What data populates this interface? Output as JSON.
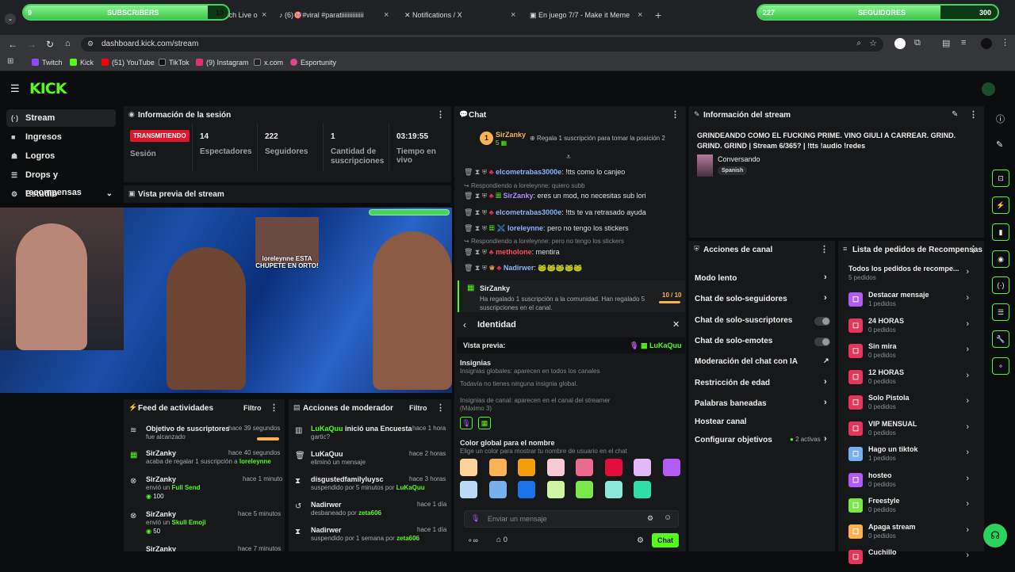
{
  "overlays": {
    "subs": {
      "current": "9",
      "label": "SUBSCRIBERS",
      "goal": "10",
      "progress": 0.9
    },
    "followers": {
      "current": "227",
      "label": "SEGUIDORES",
      "goal": "300",
      "progress": 0.76
    }
  },
  "browser": {
    "tabs": [
      {
        "label": "Watch Live o"
      },
      {
        "label": "(6)🎯#viral #paratiiiiiiiiiiiiii"
      },
      {
        "label": "Notifications / X"
      },
      {
        "label": "En juego 7/7 - Make it Meme"
      }
    ],
    "url": "dashboard.kick.com/stream",
    "bookmarks": [
      "Twitch",
      "Kick",
      "(51) YouTube",
      "TikTok",
      "(9) Instagram",
      "x.com",
      "Esportunity"
    ]
  },
  "nav": {
    "items": [
      {
        "label": "Stream"
      },
      {
        "label": "Ingresos"
      },
      {
        "label": "Logros"
      },
      {
        "label": "Drops y recompensas"
      },
      {
        "label": "Estudio"
      }
    ]
  },
  "session": {
    "title": "Información de la sesión",
    "status": "TRANSMITIENDO",
    "session_label": "Sesión",
    "stats": [
      {
        "value": "14",
        "label": "Espectadores"
      },
      {
        "value": "222",
        "label": "Seguidores"
      },
      {
        "value": "1",
        "label": "Cantidad de suscripciones"
      },
      {
        "value": "03:19:55",
        "label": "Tiempo en vivo"
      }
    ]
  },
  "preview": {
    "title": "Vista previa del stream",
    "overlay_text": "loreleynne ESTA CHUPETE EN ORTO!"
  },
  "chat": {
    "title": "Chat",
    "pinned_user": "SirZanky",
    "pinned_count": "5",
    "pinned_rank": "1",
    "gift_hint": "Regala 1 suscripción para tomar la posición 2",
    "messages": [
      {
        "user": "elcometrabas3000e",
        "text": "!tts como lo canjeo",
        "reply": ""
      },
      {
        "user": "SirZanky",
        "text": "eres un mod, no necesitas sub lori",
        "reply": "Respondiendo a loreleynne: quiero subb"
      },
      {
        "user": "elcometrabas3000e",
        "text": "!tts te va retrasado ayuda",
        "reply": ""
      },
      {
        "user": "loreleynne",
        "text": "pero no tengo los stickers",
        "reply": ""
      },
      {
        "user": "metholone",
        "text": "mentira",
        "reply": "Respondiendo a loreleynne: pero no tengo los stickers"
      },
      {
        "user": "Nadirwer",
        "text": "",
        "reply": ""
      }
    ],
    "gift_event": {
      "user": "SirZanky",
      "text": "Ha regalado 1 suscripción a la comunidad. Han regalado 5 suscripciones en el canal.",
      "progress": "10 / 10"
    },
    "identity": {
      "title": "Identidad",
      "preview_label": "Vista previa:",
      "preview_name": "LuKaQuu",
      "badges_title": "Insignias",
      "badges_global": "Insignias globales: aparecen en todos los canales",
      "badges_none": "Todavía no tienes ninguna insignia global.",
      "badges_channel": "Insignias de canal: aparecen en el canal del streamer",
      "badges_max": "(Máximo 3)",
      "color_title": "Color global para el nombre",
      "color_hint": "Elige un color para mostrar tu nombre de usuario en el chat",
      "colors": [
        "#fcd49b",
        "#fbb253",
        "#f59e0b",
        "#f9c8d4",
        "#ea6b8f",
        "#e20f3d",
        "#e2b8f7",
        "#b35cf5",
        "#b9d9f7",
        "#76b0ef",
        "#1c72e8",
        "#cdf5a4",
        "#7ae84a",
        "#8ae8d9",
        "#2ee0a8"
      ]
    },
    "input_placeholder": "Enviar un mensaje",
    "count": "0",
    "send_label": "Chat"
  },
  "stream_info": {
    "title": "Información del stream",
    "stream_title": "GRINDEANDO COMO EL FUCKING PRIME. VINO GIULI A CARREAR. GRIND. GRIND. GRIND | Stream 6/365? | !tts !audio !redes",
    "category": "Conversando",
    "tag": "Spanish"
  },
  "channel_actions": {
    "title": "Acciones de canal",
    "items": [
      {
        "label": "Modo lento"
      },
      {
        "label": "Chat de solo-seguidores"
      },
      {
        "label": "Chat de solo-suscriptores"
      },
      {
        "label": "Chat de solo-emotes"
      },
      {
        "label": "Moderación del chat con IA"
      },
      {
        "label": "Restricción de edad"
      },
      {
        "label": "Palabras baneadas"
      },
      {
        "label": "Hostear canal"
      },
      {
        "label": "Configurar objetivos"
      }
    ],
    "goals_active": "2 activas"
  },
  "rewards": {
    "title": "Lista de pedidos de Recompensas",
    "all": {
      "label": "Todos los pedidos de recompe...",
      "count": "5 pedidos"
    },
    "items": [
      {
        "label": "Destacar mensaje",
        "count": "1 pedidos",
        "color": "#b35cf5"
      },
      {
        "label": "24 HORAS",
        "count": "0 pedidos",
        "color": "#e2365a"
      },
      {
        "label": "Sin mira",
        "count": "0 pedidos",
        "color": "#e2365a"
      },
      {
        "label": "12 HORAS",
        "count": "0 pedidos",
        "color": "#e2365a"
      },
      {
        "label": "Solo Pistola",
        "count": "0 pedidos",
        "color": "#e2365a"
      },
      {
        "label": "VIP MENSUAL",
        "count": "0 pedidos",
        "color": "#e2365a"
      },
      {
        "label": "Hago un tiktok",
        "count": "1 pedidos",
        "color": "#76b0ef"
      },
      {
        "label": "hosteo",
        "count": "0 pedidos",
        "color": "#b35cf5"
      },
      {
        "label": "Freestyle",
        "count": "0 pedidos",
        "color": "#7ae84a"
      },
      {
        "label": "Apaga stream",
        "count": "0 pedidos",
        "color": "#fbb253"
      },
      {
        "label": "Cuchillo",
        "count": "",
        "color": "#e2365a"
      }
    ]
  },
  "activity": {
    "title": "Feed de actividades",
    "filter": "Filtro",
    "items": [
      {
        "name": "Objetivo de suscriptores",
        "desc": "fue alcanzado",
        "time": "hace 39 segundos",
        "extra": ""
      },
      {
        "name": "SirZanky",
        "desc": "acaba de regalar 1 suscripción a",
        "time": "hace 40 segundos",
        "extra": "loreleynne"
      },
      {
        "name": "SirZanky",
        "desc": "envió un",
        "time": "hace 1 minuto",
        "extra": "Full Send",
        "amount": "100"
      },
      {
        "name": "SirZanky",
        "desc": "envió un",
        "time": "hace 5 minutos",
        "extra": "Skull Emoji",
        "amount": "50"
      },
      {
        "name": "SirZanky",
        "desc": "",
        "time": "hace 7 minutos",
        "extra": ""
      }
    ]
  },
  "modactions": {
    "title": "Acciones de moderador",
    "filter": "Filtro",
    "items": [
      {
        "name": "LuKaQuu",
        "tail": "inició una Encuesta",
        "desc": "gartic?",
        "time": "hace 1 hora"
      },
      {
        "name": "LuKaQuu",
        "tail": "",
        "desc": "eliminó un mensaje",
        "time": "hace 2 horas"
      },
      {
        "name": "disgustedfamilyluysc",
        "tail": "",
        "desc": "suspendido por 5 minutos por",
        "by": "LuKaQuu",
        "time": "hace 3 horas"
      },
      {
        "name": "Nadirwer",
        "tail": "",
        "desc": "desbaneado por",
        "by": "zeta606",
        "time": "hace 1 día"
      },
      {
        "name": "Nadirwer",
        "tail": "",
        "desc": "suspendido por 1 semana por",
        "by": "zeta606",
        "time": "hace 1 día"
      }
    ]
  }
}
